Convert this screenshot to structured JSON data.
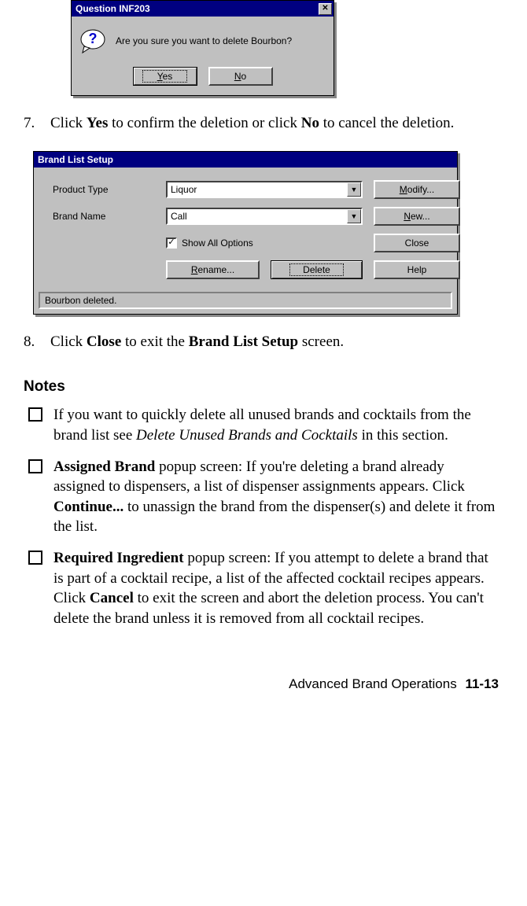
{
  "dialog1": {
    "title": "Question INF203",
    "close_glyph": "✕",
    "message": "Are you sure you want to delete Bourbon?",
    "yes_u": "Y",
    "yes_rest": "es",
    "no_u": "N",
    "no_rest": "o"
  },
  "step7": {
    "num": "7.",
    "p1": "Click ",
    "b1": "Yes",
    "p2": " to confirm the deletion or click ",
    "b2": "No",
    "p3": " to cancel the deletion."
  },
  "dialog2": {
    "title": "Brand List Setup",
    "product_type_label": "Product Type",
    "brand_name_label": "Brand Name",
    "product_type_value": "Liquor",
    "brand_name_value": "Call",
    "show_all_pre": "Show ",
    "show_all_u": "A",
    "show_all_post": "ll Options",
    "modify_u": "M",
    "modify_rest": "odify...",
    "new_u": "N",
    "new_rest": "ew...",
    "close_label": "Close",
    "help_label": "Help",
    "rename_u": "R",
    "rename_rest": "ename...",
    "delete_u": "D",
    "delete_rest": "elete",
    "status": "Bourbon deleted."
  },
  "step8": {
    "num": "8.",
    "p1": "Click ",
    "b1": "Close",
    "p2": " to exit the ",
    "b2": "Brand List Setup",
    "p3": " screen."
  },
  "notes_heading": "Notes",
  "note1": {
    "p1": "If you want to quickly delete all unused brands and cocktails from the brand list see ",
    "i1": "Delete Unused Brands and Cocktails",
    "p2": " in this section."
  },
  "note2": {
    "b1": "Assigned Brand",
    "p1": " popup screen: If you're deleting a brand already assigned to dispensers, a list of dispenser assignments appears. Click ",
    "b2": "Continue...",
    "p2": " to unassign the brand from the dispenser(s) and delete it from the list."
  },
  "note3": {
    "b1": "Required Ingredient",
    "p1": " popup screen: If you attempt to delete a brand that is part of a cocktail recipe, a list of the affected cocktail recipes appears. Click ",
    "b2": "Cancel",
    "p2": " to exit the screen and abort the deletion process. You can't delete the brand unless it is removed from all cocktail recipes."
  },
  "footer": {
    "section": "Advanced Brand Operations",
    "page": "11-13"
  }
}
